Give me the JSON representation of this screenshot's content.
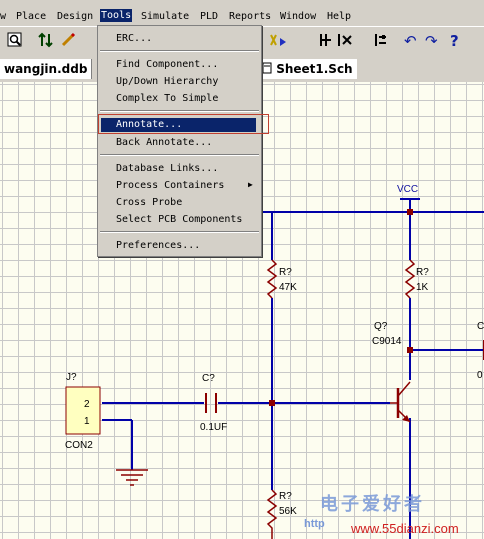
{
  "menubar": {
    "items": [
      "w",
      "Place",
      "Design",
      "Tools",
      "Simulate",
      "PLD",
      "Reports",
      "Window",
      "Help"
    ]
  },
  "tabs": {
    "database": "wangjin.ddb",
    "sheet": "Sheet1.Sch"
  },
  "tools_menu": {
    "items": [
      "ERC...",
      "Find Component...",
      "Up/Down Hierarchy",
      "Complex To Simple",
      "Annotate...",
      "Back Annotate...",
      "Database Links...",
      "Process Containers",
      "Cross Probe",
      "Select PCB Components",
      "Preferences..."
    ],
    "highlighted": "Annotate..."
  },
  "schematic": {
    "vcc": "VCC",
    "r1_ref": "R?",
    "r1_val": "47K",
    "r2_ref": "R?",
    "r2_val": "1K",
    "r3_ref": "R?",
    "r3_val": "56K",
    "q_ref": "Q?",
    "q_val": "C9014",
    "c_ref": "C?",
    "c_val": "0.1UF",
    "c2_ref": "C",
    "c2_val": "0",
    "j_ref": "J?",
    "j_val": "CON2",
    "pin2": "2",
    "pin1": "1"
  },
  "watermark": {
    "cn": "电子爱好者",
    "http": "http",
    "url": "www.55dianzi.com"
  },
  "colors": {
    "wire": "#0000a8",
    "component": "#8b0000",
    "connector_fill": "#ffffc0",
    "menu_highlight": "#0a246a",
    "annotate_frame": "#c04030"
  }
}
